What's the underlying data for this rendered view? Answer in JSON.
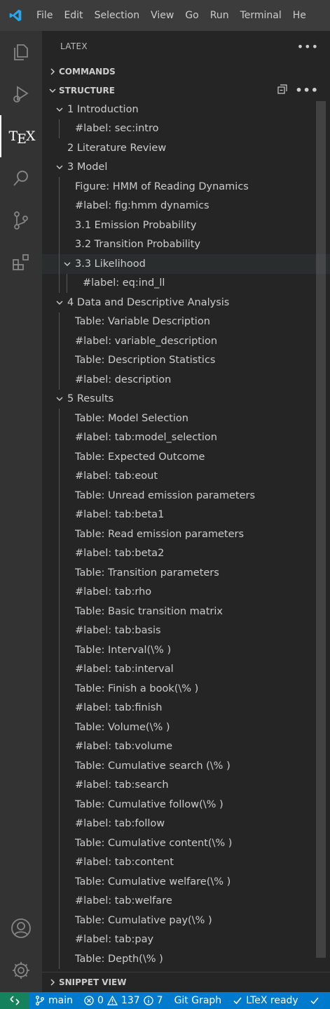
{
  "titlebar": {
    "menu": [
      "File",
      "Edit",
      "Selection",
      "View",
      "Go",
      "Run",
      "Terminal",
      "He"
    ]
  },
  "activity": {
    "items": [
      "explorer",
      "run-and-debug",
      "tex",
      "search",
      "source-control",
      "extensions",
      "accounts",
      "manage"
    ],
    "tex_label": "TEX"
  },
  "sidebar": {
    "title": "LATEX",
    "sections": {
      "commands": "COMMANDS",
      "structure": "STRUCTURE",
      "snippet_view": "SNIPPET VIEW"
    },
    "tree": [
      {
        "label": "1 Introduction",
        "level": 0,
        "expanded": true
      },
      {
        "label": "#label: sec:intro",
        "level": 1
      },
      {
        "label": "2 Literature Review",
        "level": 0
      },
      {
        "label": "3 Model",
        "level": 0,
        "expanded": true
      },
      {
        "label": "Figure: HMM of Reading Dynamics",
        "level": 1
      },
      {
        "label": "#label: fig:hmm dynamics",
        "level": 1
      },
      {
        "label": "3.1 Emission Probability",
        "level": 1
      },
      {
        "label": "3.2 Transition Probability",
        "level": 1
      },
      {
        "label": "3.3 Likelihood",
        "level": 1,
        "expanded": true,
        "hover": true
      },
      {
        "label": "#label: eq:ind_ll",
        "level": 2
      },
      {
        "label": "4 Data and Descriptive Analysis",
        "level": 0,
        "expanded": true
      },
      {
        "label": "Table: Variable Description",
        "level": 1
      },
      {
        "label": "#label: variable_description",
        "level": 1
      },
      {
        "label": "Table: Description Statistics",
        "level": 1
      },
      {
        "label": "#label: description",
        "level": 1
      },
      {
        "label": "5 Results",
        "level": 0,
        "expanded": true
      },
      {
        "label": "Table: Model Selection",
        "level": 1
      },
      {
        "label": "#label: tab:model_selection",
        "level": 1
      },
      {
        "label": "Table: Expected Outcome",
        "level": 1
      },
      {
        "label": "#label: tab:eout",
        "level": 1
      },
      {
        "label": "Table: Unread emission parameters",
        "level": 1
      },
      {
        "label": "#label: tab:beta1",
        "level": 1
      },
      {
        "label": "Table: Read emission parameters",
        "level": 1
      },
      {
        "label": "#label: tab:beta2",
        "level": 1
      },
      {
        "label": "Table: Transition parameters",
        "level": 1
      },
      {
        "label": "#label: tab:rho",
        "level": 1
      },
      {
        "label": "Table: Basic transition matrix",
        "level": 1
      },
      {
        "label": "#label: tab:basis",
        "level": 1
      },
      {
        "label": "Table: Interval(\\% )",
        "level": 1
      },
      {
        "label": "#label: tab:interval",
        "level": 1
      },
      {
        "label": "Table: Finish a book(\\% )",
        "level": 1
      },
      {
        "label": "#label: tab:finish",
        "level": 1
      },
      {
        "label": "Table: Volume(\\% )",
        "level": 1
      },
      {
        "label": "#label: tab:volume",
        "level": 1
      },
      {
        "label": "Table: Cumulative search (\\% )",
        "level": 1
      },
      {
        "label": "#label: tab:search",
        "level": 1
      },
      {
        "label": "Table: Cumulative follow(\\% )",
        "level": 1
      },
      {
        "label": "#label: tab:follow",
        "level": 1
      },
      {
        "label": "Table: Cumulative content(\\% )",
        "level": 1
      },
      {
        "label": "#label: tab:content",
        "level": 1
      },
      {
        "label": "Table: Cumulative welfare(\\% )",
        "level": 1
      },
      {
        "label": "#label: tab:welfare",
        "level": 1
      },
      {
        "label": "Table: Cumulative pay(\\% )",
        "level": 1
      },
      {
        "label": "#label: tab:pay",
        "level": 1
      },
      {
        "label": "Table: Depth(\\% )",
        "level": 1
      }
    ]
  },
  "statusbar": {
    "branch": "main",
    "errors": "0",
    "warnings": "137",
    "info": "7",
    "git_graph": "Git Graph",
    "ltex": "LTeX ready"
  },
  "colors": {
    "accent": "#007acc",
    "remote": "#16825d",
    "logo": "#23a9f2"
  }
}
